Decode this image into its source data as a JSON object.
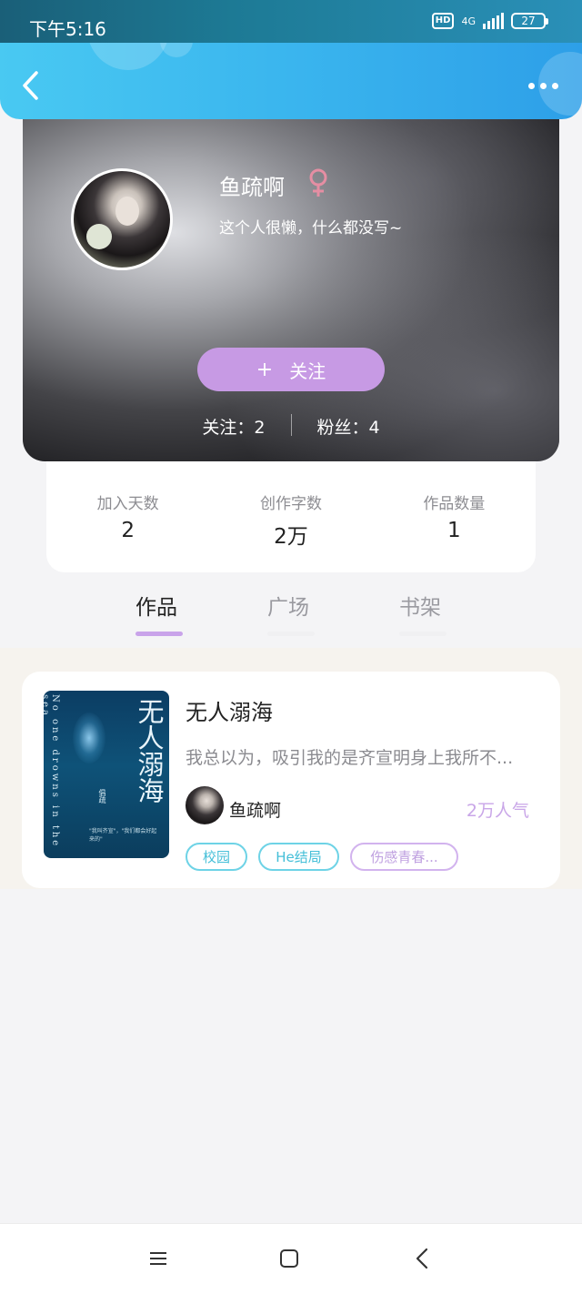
{
  "status_bar": {
    "time": "下午5:16",
    "hd_label": "HD",
    "network": "4G",
    "battery": "27"
  },
  "header": {
    "back_icon": "chevron-left-icon",
    "more_icon": "more-horizontal-icon"
  },
  "profile": {
    "username": "鱼疏啊",
    "gender_icon": "female-icon",
    "gender_color": "#e58ea3",
    "bio": "这个人很懒，什么都没写~",
    "follow_icon": "+",
    "follow_label": "关注",
    "follow_color": "#c79ae4",
    "following": "关注：2",
    "fans": "粉丝：4"
  },
  "stats": [
    {
      "label": "加入天数",
      "value": "2"
    },
    {
      "label": "创作字数",
      "value": "2万"
    },
    {
      "label": "作品数量",
      "value": "1"
    }
  ],
  "tabs": [
    {
      "label": "作品",
      "active": true
    },
    {
      "label": "广场",
      "active": false
    },
    {
      "label": "书架",
      "active": false
    }
  ],
  "books": [
    {
      "title": "无人溺海",
      "cover_title": "无人溺海",
      "cover_subtitle": "No one drowns in the sea",
      "cover_author": "倡疏",
      "cover_quote": "\"我叫齐宣\"，\"我们都会好起来的\"",
      "description": "我总以为，吸引我的是齐宣明身上我所不...",
      "author": "鱼疏啊",
      "popularity": "2万人气",
      "tags": [
        "校园",
        "He结局",
        "伤感青春..."
      ]
    }
  ],
  "nav_bar": {
    "menu_icon": "menu-icon",
    "home_icon": "home-square-icon",
    "back_icon": "back-triangle-icon"
  }
}
